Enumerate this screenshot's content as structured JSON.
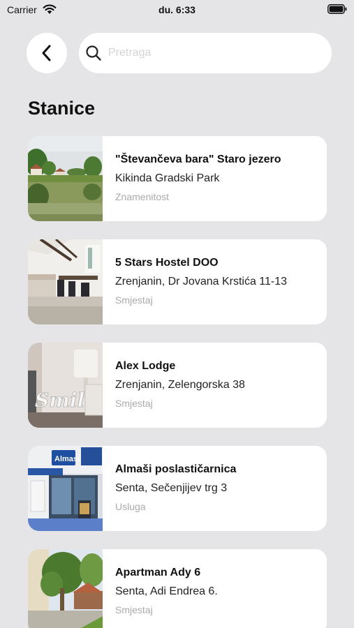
{
  "status_bar": {
    "carrier": "Carrier",
    "time": "du. 6:33"
  },
  "header": {
    "back_icon": "chevron-left-icon",
    "search_icon": "search-icon",
    "search_placeholder": "Pretraga",
    "search_value": ""
  },
  "page": {
    "title": "Stanice"
  },
  "stations": [
    {
      "title": "\"Števančeva bara\" Staro jezero",
      "subtitle": "Kikinda Gradski Park",
      "category": "Znamenitost"
    },
    {
      "title": "5 Stars Hostel DOO",
      "subtitle": "Zrenjanin, Dr Jovana Krstića 11-13",
      "category": "Smjestaj"
    },
    {
      "title": "Alex Lodge",
      "subtitle": "Zrenjanin, Zelengorska 38",
      "category": "Smjestaj"
    },
    {
      "title": "Almaši poslastičarnica",
      "subtitle": "Senta, Sečenjijev trg 3",
      "category": "Usluga"
    },
    {
      "title": "Apartman Ady 6",
      "subtitle": "Senta, Adi Endrea 6.",
      "category": "Smjestaj"
    }
  ],
  "thumb_texts": {
    "smile": "Smil",
    "almasi": "Almasi"
  }
}
